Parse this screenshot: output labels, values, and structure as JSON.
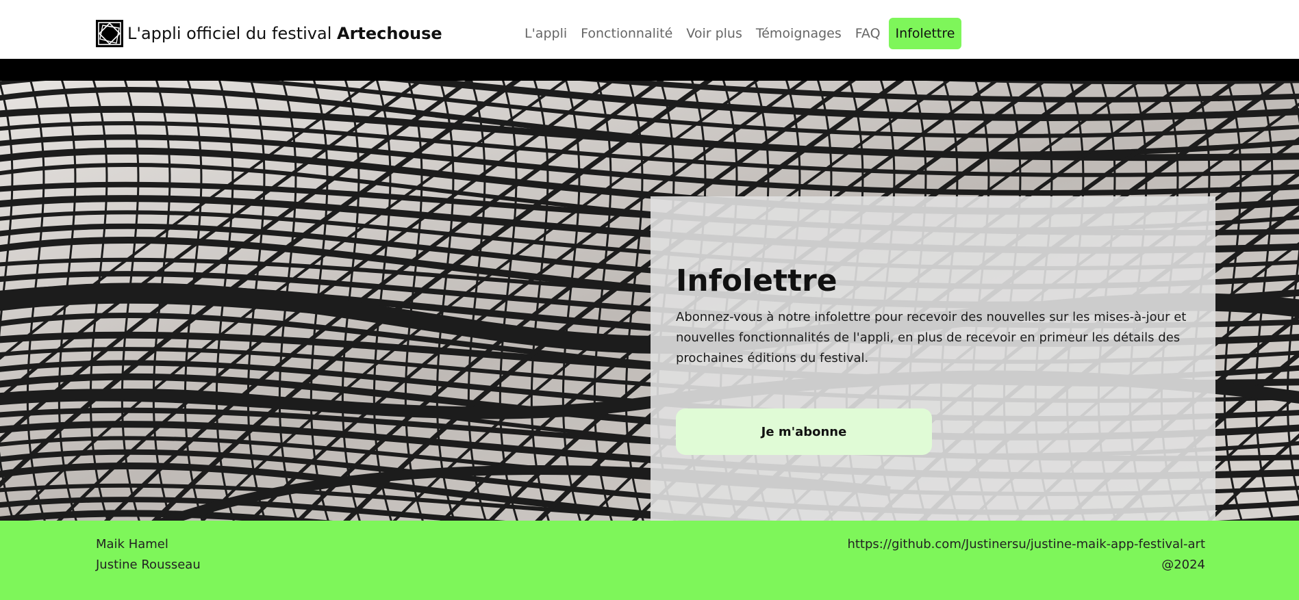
{
  "header": {
    "brand_prefix": "L'appli officiel du festival",
    "brand_name": "Artechouse",
    "logo_icon": "artechouse-logo-icon"
  },
  "nav": {
    "items": [
      {
        "label": "L'appli"
      },
      {
        "label": "Fonctionnalité"
      },
      {
        "label": "Voir plus"
      },
      {
        "label": "Témoignages"
      },
      {
        "label": "FAQ"
      },
      {
        "label": "Infolettre",
        "active": true
      }
    ]
  },
  "hero": {
    "title": "Infolettre",
    "text": "Abonnez-vous à notre infolettre pour recevoir des nouvelles sur les mises-à-jour et nouvelles fonctionnalités de l'appli, en plus de recevoir en primeur les détails des prochaines éditions du festival.",
    "button_label": "Je m'abonne"
  },
  "footer": {
    "authors": [
      "Maik Hamel",
      "Justine Rousseau"
    ],
    "repo_link": "https://github.com/Justinersu/justine-maik-app-festival-art",
    "copyright": "@2024"
  },
  "colors": {
    "accent": "#7ef65a",
    "button_bg": "#e0fbd6",
    "card_bg": "#e0e0e0",
    "bar": "#000000"
  }
}
